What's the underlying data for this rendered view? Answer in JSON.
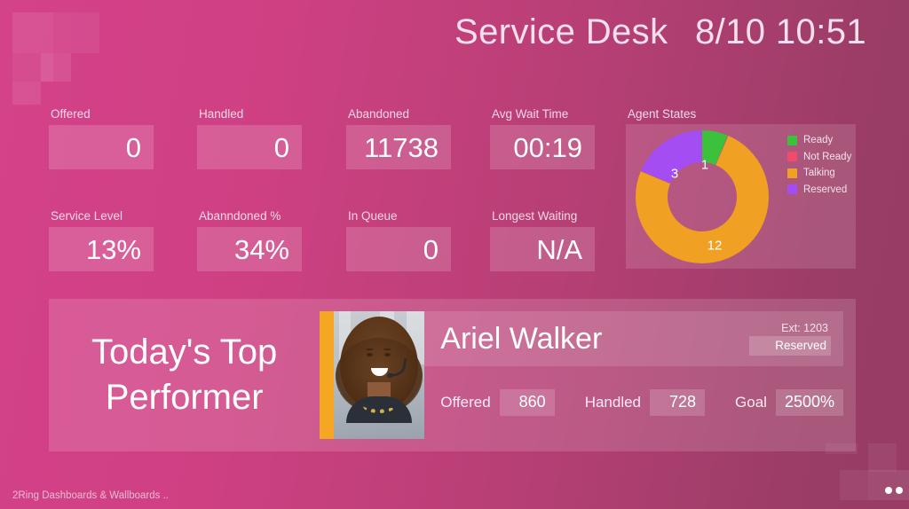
{
  "header": {
    "title": "Service Desk",
    "datetime": "8/10 10:51"
  },
  "kpis": [
    {
      "label": "Offered",
      "value": "0"
    },
    {
      "label": "Handled",
      "value": "0"
    },
    {
      "label": "Abandoned",
      "value": "11738"
    },
    {
      "label": "Avg Wait Time",
      "value": "00:19"
    },
    {
      "label": "Service Level",
      "value": "13%"
    },
    {
      "label": "Abanndoned %",
      "value": "34%"
    },
    {
      "label": "In Queue",
      "value": "0"
    },
    {
      "label": "Longest Waiting",
      "value": "N/A"
    }
  ],
  "agent_states": {
    "label": "Agent States",
    "legend": [
      {
        "name": "Ready",
        "color": "#3cc13c"
      },
      {
        "name": "Not Ready",
        "color": "#f04a6e"
      },
      {
        "name": "Talking",
        "color": "#f0a023"
      },
      {
        "name": "Reserved",
        "color": "#a44df2"
      }
    ],
    "slice_labels": {
      "ready": "1",
      "reserved": "3",
      "talking": "12"
    }
  },
  "chart_data": {
    "type": "pie",
    "title": "Agent States",
    "categories": [
      "Ready",
      "Not Ready",
      "Talking",
      "Reserved"
    ],
    "values": [
      1,
      0,
      12,
      3
    ],
    "colors": [
      "#3cc13c",
      "#f04a6e",
      "#f0a023",
      "#a44df2"
    ],
    "total": 16,
    "donut": true,
    "legend_position": "right",
    "start_angle_deg": 0,
    "direction": "clockwise"
  },
  "top_performer": {
    "panel_title": "Today's Top Performer",
    "agent_name": "Ariel Walker",
    "extension": "Ext: 1203",
    "state": "Reserved",
    "stats": [
      {
        "label": "Offered",
        "value": "860"
      },
      {
        "label": "Handled",
        "value": "728"
      },
      {
        "label": "Goal",
        "value": "2500%"
      }
    ],
    "photo_alt": "agent-photo"
  },
  "footer": {
    "text": "2Ring Dashboards & Wallboards .."
  }
}
